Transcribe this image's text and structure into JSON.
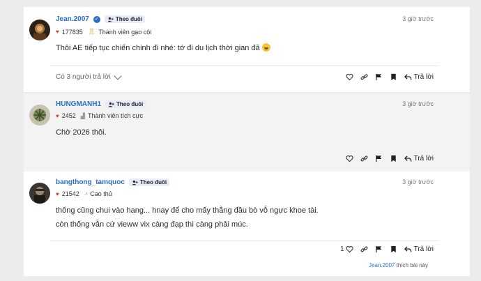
{
  "posts": [
    {
      "username": "Jean.2007",
      "verified": true,
      "follow_label": "Theo đuôi",
      "time": "3 giờ trước",
      "likes": "177835",
      "rank_icon": "ribbon-icon",
      "rank": "Thành viên gạo cội",
      "body": [
        "Thôi AE tiếp tục chiến chinh đi nhé: tớ đi du lịch thời gian đã"
      ],
      "has_emoji": true,
      "replies_label": "Có 3 người trả lời",
      "reply_label": "Trả lời",
      "like_count": ""
    },
    {
      "username": "HUNGMANH1",
      "verified": false,
      "follow_label": "Theo đuôi",
      "time": "3 giờ trước",
      "likes": "2452",
      "rank_icon": "bars-icon",
      "rank": "Thành viên tích cực",
      "body": [
        "Chờ 2026 thôi."
      ],
      "reply_label": "Trả lời",
      "like_count": ""
    },
    {
      "username": "bangthong_tamquoc",
      "verified": false,
      "follow_label": "Theo đuôi",
      "time": "3 giờ trước",
      "likes": "21542",
      "rank_icon": "chart-icon",
      "rank": "Cao thủ",
      "body": [
        "thống cũng chui vào hang... hnay để cho mấy thằng đầu bò vỗ ngực khoe tài.",
        "còn thống vẫn cứ vieww vix càng đạp thì càng phải múc."
      ],
      "reply_label": "Trả lời",
      "like_count": "1",
      "liked_by_user": "Jean.2007",
      "liked_by_suffix": "thích bài này"
    }
  ],
  "colors": {
    "link": "#2a6fc9",
    "heart": "#d9342b",
    "gray_bg": "#f3f3f3"
  }
}
